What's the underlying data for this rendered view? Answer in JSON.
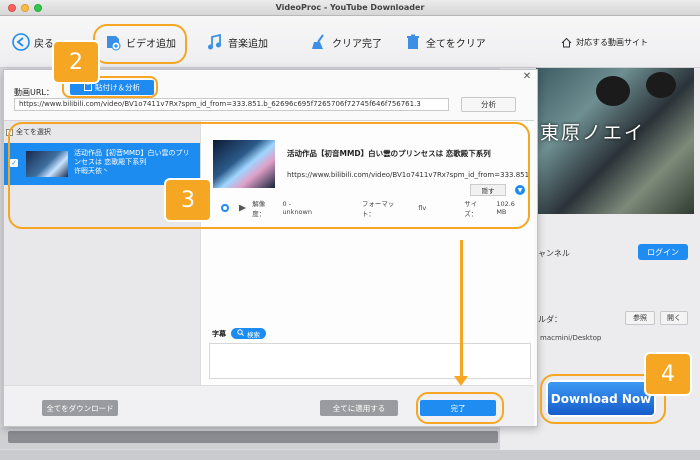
{
  "window": {
    "title": "VideoProc - YouTube Downloader"
  },
  "toolbar": {
    "back_label": "戻る",
    "add_video_label": "ビデオ追加",
    "add_music_label": "音楽追加",
    "clear_done_label": "クリア完了",
    "clear_all_label": "全てをクリア",
    "supported_sites_label": "対応する動画サイト"
  },
  "dialog": {
    "url_label": "動画URL：",
    "paste_analyze_label": "貼付け＆分析",
    "url_value": "https://www.bilibili.com/video/BV1o7411v7Rx?spm_id_from=333.851.b_62696c695f7265706f72745f646f756761.3",
    "analyze_label": "分析",
    "select_all_label": "全てを選択",
    "list_item": {
      "title": "活动作品【初音MMD】白い雲のプリンセスは 恋歌殿下系列",
      "subtitle": "许暇天依丶"
    },
    "detail": {
      "title": "活动作品【初音MMD】白い雲のプリンセスは 恋歌殿下系列",
      "url": "https://www.bilibili.com/video/BV1o7411v7Rx?spm_id_from=333.851.b_6269",
      "hide_label": "隠す",
      "resolution_label": "解像度：",
      "resolution_value": "0 - unknown",
      "format_label": "フォーマット：",
      "format_value": "flv",
      "size_label": "サイズ：",
      "size_value": "102.6 MB"
    },
    "subtitle_label": "字幕",
    "subtitle_search_label": "検索",
    "download_all_label": "全てをダウンロード",
    "apply_all_label": "全てに適用する",
    "done_label": "完了"
  },
  "right_panel": {
    "thumb_text": "東原ノエイ",
    "channel_label": "ャンネル",
    "login_label": "ログイン",
    "folder_label": "ルダ：",
    "browse_label": "参照",
    "open_label": "開く",
    "path_value": "macmini/Desktop",
    "download_now_label": "Download Now"
  },
  "callouts": [
    "2",
    "3",
    "4"
  ],
  "colors": {
    "accent": "#1d8cf0",
    "callout": "#f5a623"
  }
}
